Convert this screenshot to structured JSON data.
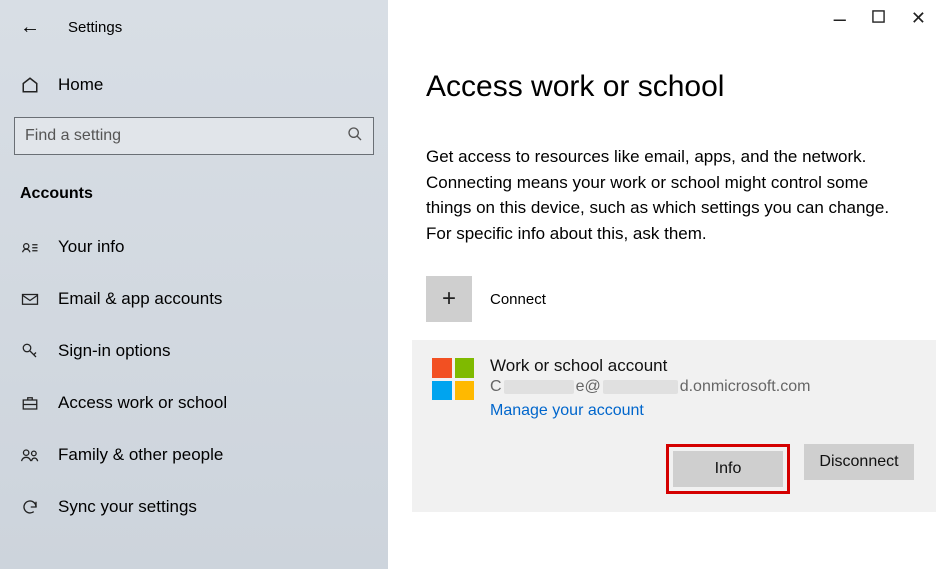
{
  "sidebar": {
    "app_title": "Settings",
    "home_label": "Home",
    "search_placeholder": "Find a setting",
    "section_header": "Accounts",
    "items": [
      {
        "label": "Your info"
      },
      {
        "label": "Email & app accounts"
      },
      {
        "label": "Sign-in options"
      },
      {
        "label": "Access work or school"
      },
      {
        "label": "Family & other people"
      },
      {
        "label": "Sync your settings"
      }
    ]
  },
  "main": {
    "title": "Access work or school",
    "description": "Get access to resources like email, apps, and the network. Connecting means your work or school might control some things on this device, such as which settings you can change. For specific info about this, ask them.",
    "connect_label": "Connect",
    "account": {
      "title": "Work or school account",
      "email_prefix": "C",
      "email_mid": "e@",
      "email_suffix": "d.onmicrosoft.com",
      "manage_label": "Manage your account",
      "info_label": "Info",
      "disconnect_label": "Disconnect"
    }
  }
}
